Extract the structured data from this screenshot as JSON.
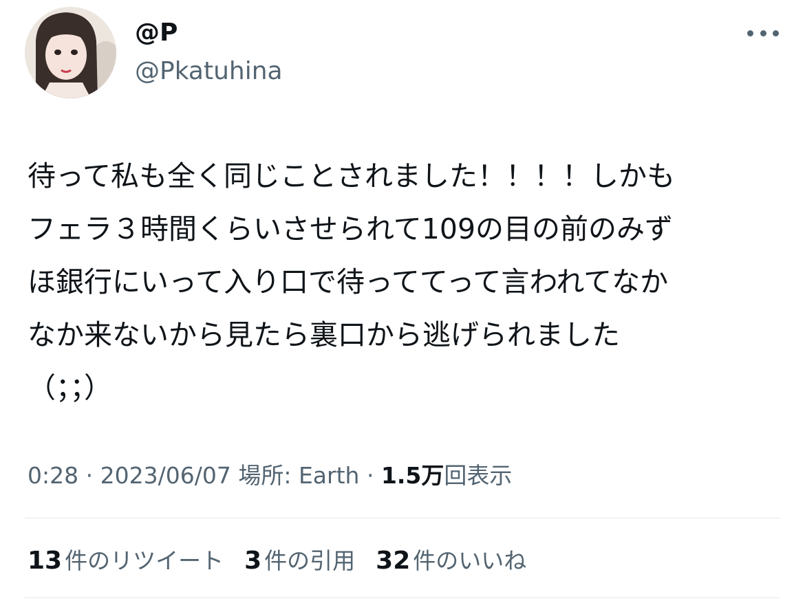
{
  "author": {
    "display_name": "@P",
    "handle": "@Pkatuhina"
  },
  "tweet": {
    "text": "待って私も全く同じことされました！！！！しかも\nフェラ３時間くらいさせられて109の目の前のみず\nほ銀行にいって入り口で待っててって言われてなか\nなか来ないから見たら裏口から逃げられました\n（；；）"
  },
  "meta": {
    "time": "0:28",
    "separator": "·",
    "date": "2023/06/07",
    "location_label": "場所:",
    "location": "Earth",
    "views_count": "1.5万",
    "views_label": "回表示"
  },
  "stats": [
    {
      "count": "13",
      "label": "件のリツイート"
    },
    {
      "count": "3",
      "label": "件の引用"
    },
    {
      "count": "32",
      "label": "件のいいね"
    }
  ],
  "icons": {
    "more": "more-horizontal-icon",
    "avatar": "profile-photo"
  }
}
